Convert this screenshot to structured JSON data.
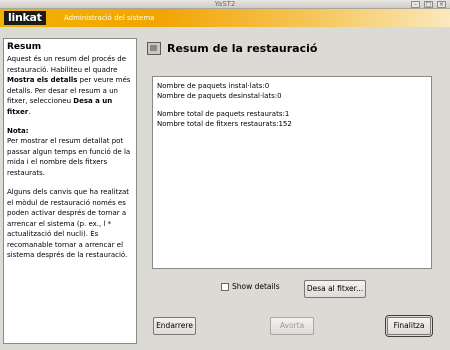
{
  "window": {
    "title": "YaST2",
    "controls": [
      "–",
      "□",
      "×"
    ]
  },
  "banner": {
    "logo": "linkat",
    "subtitle": "Administració del sistema"
  },
  "help": {
    "title": "Resum",
    "p1_a": "Aquest és un resum del procés de restauració. Habiliteu el quadre ",
    "p1_b": "Mostra els detalls",
    "p1_c": " per veure més detalls. Per desar el resum a un fitxer, seleccioneu ",
    "p1_d": "Desa a un fitxer",
    "p1_e": ".",
    "note_heading": "Nota:",
    "note_text": "Per mostrar el resum detallat pot passar algun temps en funció de la mida i el nombre dels fitxers restaurats.",
    "p3": "Alguns dels canvis que ha realitzat el mòdul de restauració només es poden activar després de tornar a arrencar el sistema (p. ex., l * actualització del nucli). És recomanable tornar a arrencar el sistema després de la restauració."
  },
  "main": {
    "heading": "Resum de la restauració",
    "heading_icon": "restore-summary-icon",
    "summary": {
      "installed": "Nombre de paquets instal·lats:0",
      "uninstalled": "Nombre de paquets desinstal·lats:0",
      "restored_packages": "Nombre total de paquets restaurats:1",
      "restored_files": "Nombre total de fitxers restaurats:152"
    },
    "show_details": {
      "label": "Show details",
      "checked": false
    },
    "save_button": "Desa al fitxer..."
  },
  "footer": {
    "back": "Endarrere",
    "abort": "Avorta",
    "finish": "Finalitza"
  }
}
